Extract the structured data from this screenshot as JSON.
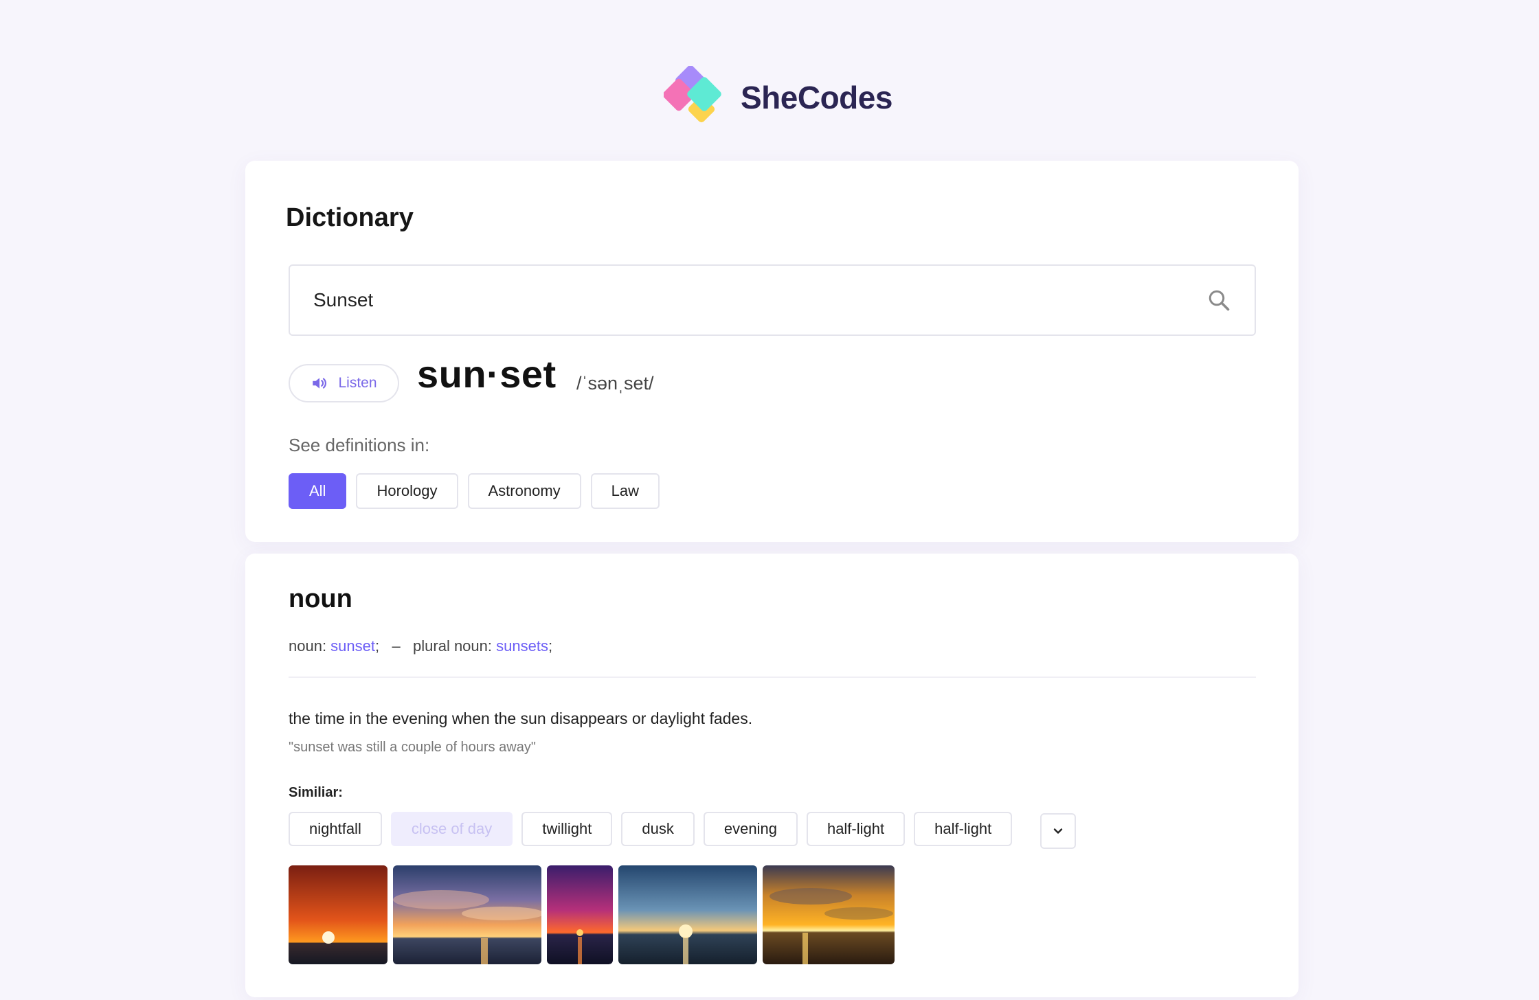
{
  "brand": {
    "name": "SheCodes"
  },
  "app": {
    "title": "Dictionary"
  },
  "search": {
    "value": "Sunset"
  },
  "entry": {
    "listen_label": "Listen",
    "headword": "sun·set",
    "phonetic": "/ˈsənˌset/"
  },
  "filters": {
    "label": "See definitions in:",
    "items": [
      "All",
      "Horology",
      "Astronomy",
      "Law"
    ],
    "active": "All"
  },
  "noun": {
    "part_of_speech": "noun",
    "form_label": "noun: ",
    "form_value": "sunset",
    "separator": ";   –   ",
    "plural_label": "plural noun: ",
    "plural_value": "sunsets",
    "end": ";",
    "definition": "the time in the evening when the sun disappears or daylight fades.",
    "example": "\"sunset was still a couple of hours away\"",
    "similar_label": "Similiar:",
    "similar": [
      "nightfall",
      "close of day",
      "twillight",
      "dusk",
      "evening",
      "half-light",
      "half-light"
    ]
  },
  "colors": {
    "accent": "#6c5ef6",
    "background": "#f7f5fc",
    "card": "#ffffff"
  },
  "icons": {
    "search": "search-icon",
    "speaker": "speaker-icon",
    "expand": "chevron-down-icon"
  }
}
